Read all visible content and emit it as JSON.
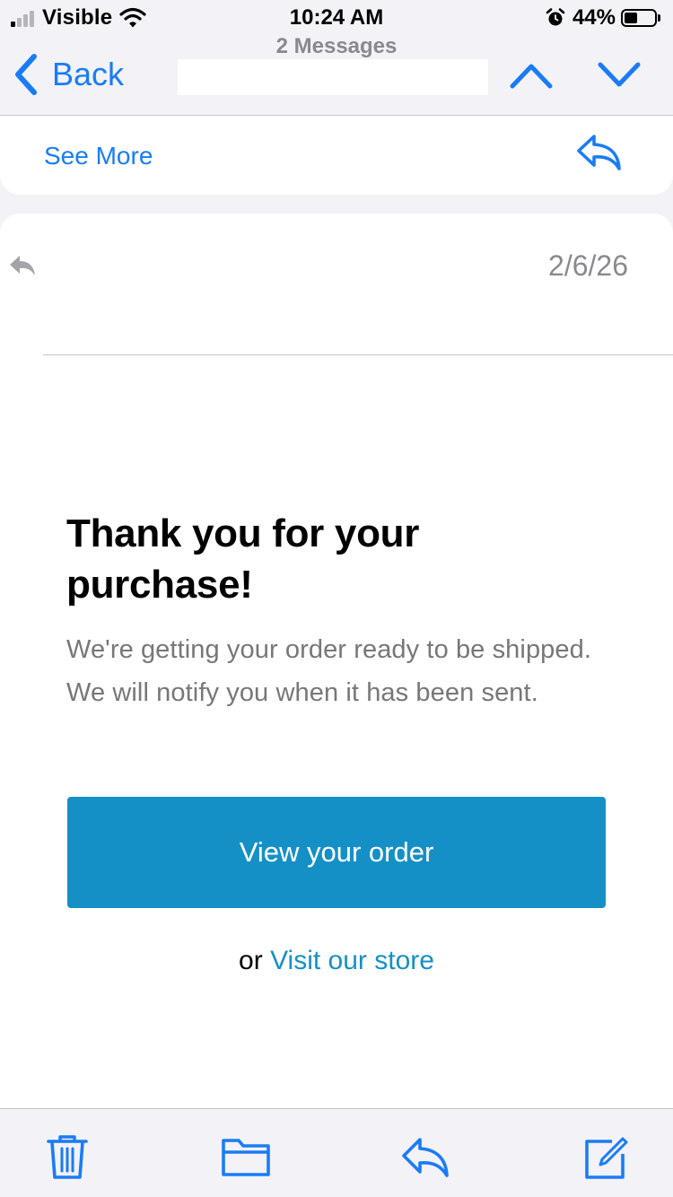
{
  "status_bar": {
    "carrier": "Visible",
    "time": "10:24 AM",
    "battery_percent": "44%",
    "battery_level": 0.44,
    "signal_bars_active": 1,
    "signal_bars_total": 4
  },
  "nav": {
    "back_label": "Back",
    "subtitle": "2 Messages"
  },
  "previous_message": {
    "see_more_label": "See More"
  },
  "message": {
    "date": "2/6/26",
    "title": "Thank you for your purchase!",
    "body": "We're getting your order ready to be shipped. We will notify you when it has been sent.",
    "primary_button": "View your order",
    "or_text": "or",
    "store_link": "Visit our store"
  },
  "colors": {
    "ios_blue": "#1a7cf5",
    "brand_blue": "#1590c7",
    "secondary_text": "#777777",
    "background": "#f2f2f7"
  },
  "icons": {
    "nav_back": "chevron-left-icon",
    "nav_prev": "chevron-up-icon",
    "nav_next": "chevron-down-icon",
    "reply": "reply-icon",
    "reply_indicator": "replied-arrow-icon",
    "toolbar": [
      "trash-icon",
      "folder-icon",
      "reply-icon",
      "compose-icon"
    ]
  }
}
